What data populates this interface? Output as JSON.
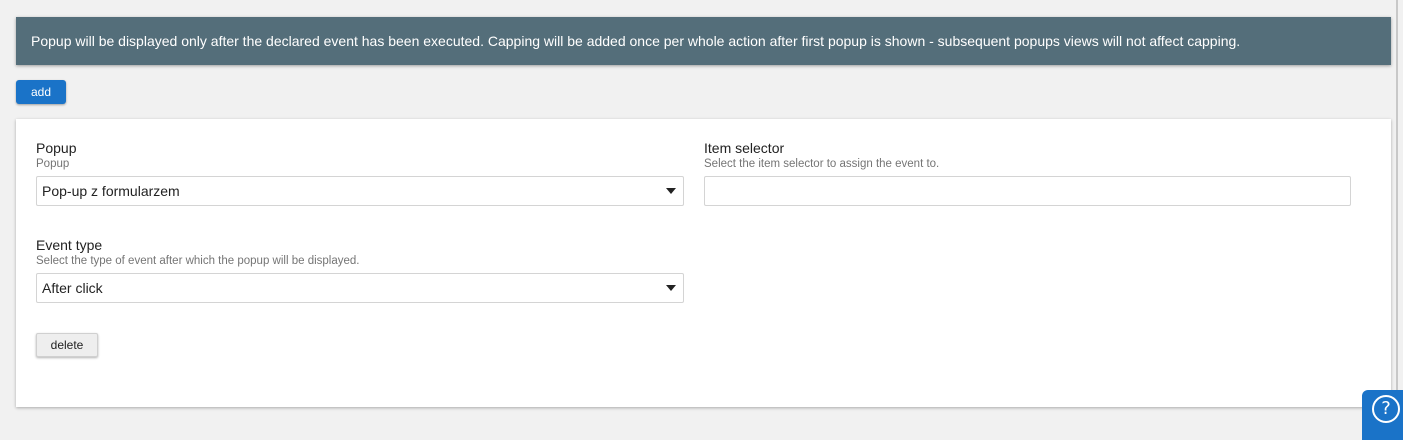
{
  "info_message": "Popup will be displayed only after the declared event has been executed. Capping will be added once per whole action after first popup is shown - subsequent popups views will not affect capping.",
  "add_button": "add",
  "form": {
    "popup": {
      "label": "Popup",
      "hint": "Popup",
      "selected": "Pop-up z formularzem"
    },
    "item_selector": {
      "label": "Item selector",
      "hint": "Select the item selector to assign the event to.",
      "value": ""
    },
    "event_type": {
      "label": "Event type",
      "hint": "Select the type of event after which the popup will be displayed.",
      "selected": "After click"
    },
    "delete_button": "delete"
  },
  "help": {
    "glyph": "?"
  },
  "colors": {
    "info_bar": "#546e7a",
    "primary": "#1a73c8",
    "page_background": "#f1f1f1"
  }
}
